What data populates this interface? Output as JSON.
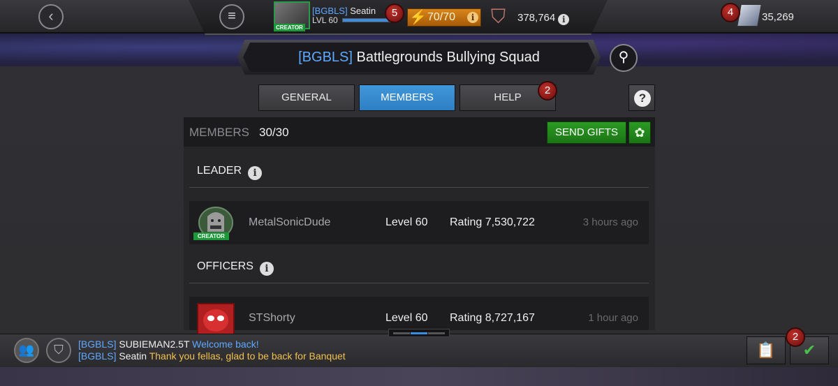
{
  "header": {
    "back_icon": "back-arrow-icon",
    "menu_icon": "hamburger-menu-icon",
    "player": {
      "tag": "[BGBLS]",
      "name": "Seatin",
      "level_label": "LVL 60",
      "creator_label": "CREATOR",
      "notification_count": "5",
      "xp_progress": 0.95
    },
    "energy": {
      "value": "70/70",
      "info": "i"
    },
    "rating": {
      "value": "378,764",
      "info": "i"
    },
    "units": {
      "value": "35,269",
      "notification_count": "4"
    }
  },
  "alliance": {
    "tag": "[BGBLS]",
    "name": "Battlegrounds Bullying Squad"
  },
  "tabs": [
    {
      "label": "GENERAL",
      "active": false
    },
    {
      "label": "MEMBERS",
      "active": true
    },
    {
      "label": "HELP",
      "active": false,
      "badge": "2"
    }
  ],
  "help_button": "?",
  "members_panel": {
    "label": "MEMBERS",
    "count": "30/30",
    "send_gifts_label": "SEND GIFTS",
    "sections": {
      "leader": {
        "label": "LEADER",
        "info": "i"
      },
      "officers": {
        "label": "OFFICERS",
        "info": "i"
      }
    },
    "leader": {
      "name": "MetalSonicDude",
      "level": "Level 60",
      "rating": "Rating 7,530,722",
      "last_seen": "3 hours ago",
      "creator_label": "CREATOR"
    },
    "officers": [
      {
        "name": "STShorty",
        "level": "Level 60",
        "rating": "Rating 8,727,167",
        "last_seen": "1 hour ago"
      }
    ]
  },
  "chat": {
    "messages": [
      {
        "tag": "[BGBLS]",
        "user": "SUBIEMAN2.5T",
        "text": "Welcome back!"
      },
      {
        "tag": "[BGBLS]",
        "user": "Seatin",
        "text": "Thank you fellas, glad to be back for Banquet"
      }
    ],
    "quests_badge": "2"
  },
  "colors": {
    "accent_blue": "#3f97d8",
    "alliance_tag": "#5fa8ff",
    "gift_green": "#2b9a24",
    "badge_red": "#c0302a",
    "energy_orange": "#d8861a"
  }
}
